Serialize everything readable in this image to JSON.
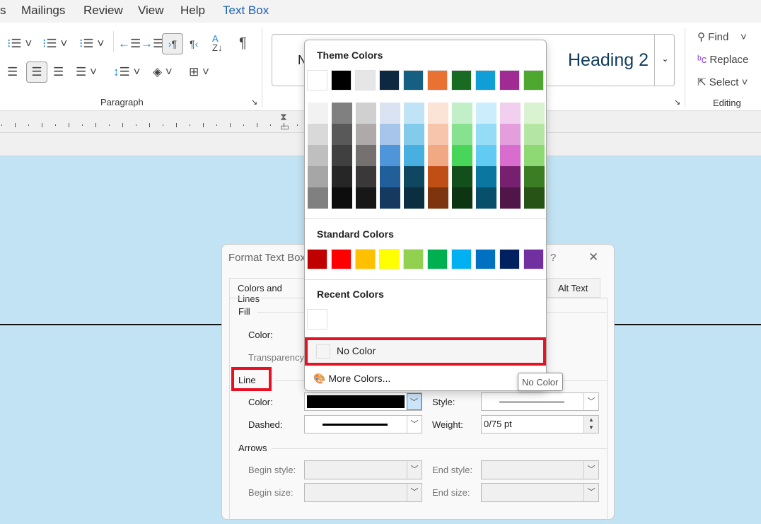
{
  "menubar": {
    "tabs": [
      "s",
      "Mailings",
      "Review",
      "View",
      "Help",
      "Text Box"
    ],
    "active_tab_color": "#1a5fb4"
  },
  "ribbon": {
    "paragraph_label": "Paragraph",
    "styles": {
      "first_style_partial": "N",
      "heading2": "Heading 2"
    },
    "editing": {
      "find": "Find",
      "replace": "Replace",
      "select": "Select",
      "label": "Editing"
    }
  },
  "dialog": {
    "title": "Format Text Box",
    "help": "?",
    "close": "✕",
    "tabs": [
      "Colors and Lines",
      "Alt Text"
    ],
    "fill": {
      "section": "Fill",
      "color_label": "Color:",
      "transparency_label": "Transparency"
    },
    "line": {
      "section": "Line",
      "color_label": "Color:",
      "color_value": "#000000",
      "dashed_label": "Dashed:",
      "style_label": "Style:",
      "weight_label": "Weight:",
      "weight_value": "0/75 pt"
    },
    "arrows": {
      "section": "Arrows",
      "begin_style": "Begin style:",
      "end_style": "End style:",
      "begin_size": "Begin size:",
      "end_size": "End size:"
    }
  },
  "color_popup": {
    "theme_title": "Theme Colors",
    "theme_top": [
      "#ffffff",
      "#000000",
      "#e7e6e6",
      "#0e2841",
      "#156082",
      "#e97132",
      "#196b24",
      "#0f9ed5",
      "#a02b93",
      "#4ea72e"
    ],
    "theme_shades": [
      [
        "#f2f2f2",
        "#d9d9d9",
        "#bfbfbf",
        "#a6a6a6",
        "#808080"
      ],
      [
        "#808080",
        "#595959",
        "#404040",
        "#262626",
        "#0d0d0d"
      ],
      [
        "#d0d0d0",
        "#aeaaaa",
        "#757171",
        "#3a3838",
        "#171717"
      ],
      [
        "#dae3f2",
        "#a5c6ea",
        "#4e95d9",
        "#215f9a",
        "#153961"
      ],
      [
        "#c0e4f5",
        "#83cbeb",
        "#47b0e1",
        "#0f4761",
        "#0b2e40"
      ],
      [
        "#fbe3d6",
        "#f6c5ac",
        "#f1a983",
        "#c04f15",
        "#7f3410"
      ],
      [
        "#c1f0c8",
        "#86e28f",
        "#47d55a",
        "#124f1a",
        "#0d3512"
      ],
      [
        "#caeefb",
        "#95dcf7",
        "#61cbf3",
        "#0b76a0",
        "#074f6a"
      ],
      [
        "#f2cfee",
        "#e59edd",
        "#d86dcd",
        "#782070",
        "#501549"
      ],
      [
        "#d9f2d0",
        "#b4e5a2",
        "#8ed973",
        "#3b7d23",
        "#275317"
      ]
    ],
    "standard_title": "Standard Colors",
    "standard": [
      "#c00000",
      "#ff0000",
      "#ffc000",
      "#ffff00",
      "#92d050",
      "#00b050",
      "#00b0f0",
      "#0070c0",
      "#002060",
      "#7030a0"
    ],
    "recent_title": "Recent Colors",
    "recent": [
      "#ffffff"
    ],
    "no_color": "No Color",
    "more_colors": "More Colors...",
    "highlight_color": "#e81123"
  },
  "tooltip": "No Color"
}
